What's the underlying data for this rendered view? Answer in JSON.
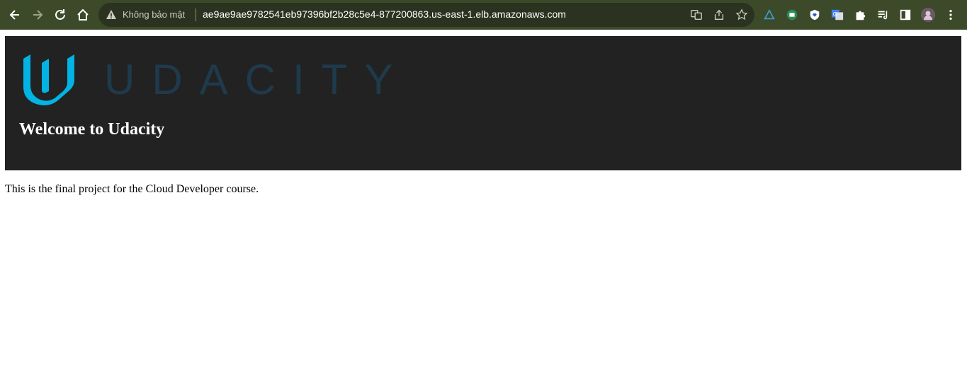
{
  "browser": {
    "security_label": "Không bảo mật",
    "url": "ae9ae9ae9782541eb97396bf2b28c5e4-877200863.us-east-1.elb.amazonaws.com",
    "toolbar_color": "#3c4a2a",
    "icons": [
      "back-icon",
      "forward-icon",
      "reload-icon",
      "home-icon",
      "warning-icon",
      "translate-icon",
      "share-icon",
      "bookmark-star-icon",
      "extension-icons",
      "puzzle-icon",
      "reading-list-icon",
      "side-panel-icon",
      "profile-avatar",
      "more-icon"
    ]
  },
  "page": {
    "logo_text": "UDACITY",
    "heading": "Welcome to Udacity",
    "body": "This is the final project for the Cloud Developer course.",
    "header_bg": "#222222",
    "logo_color": "#02b3e4"
  }
}
